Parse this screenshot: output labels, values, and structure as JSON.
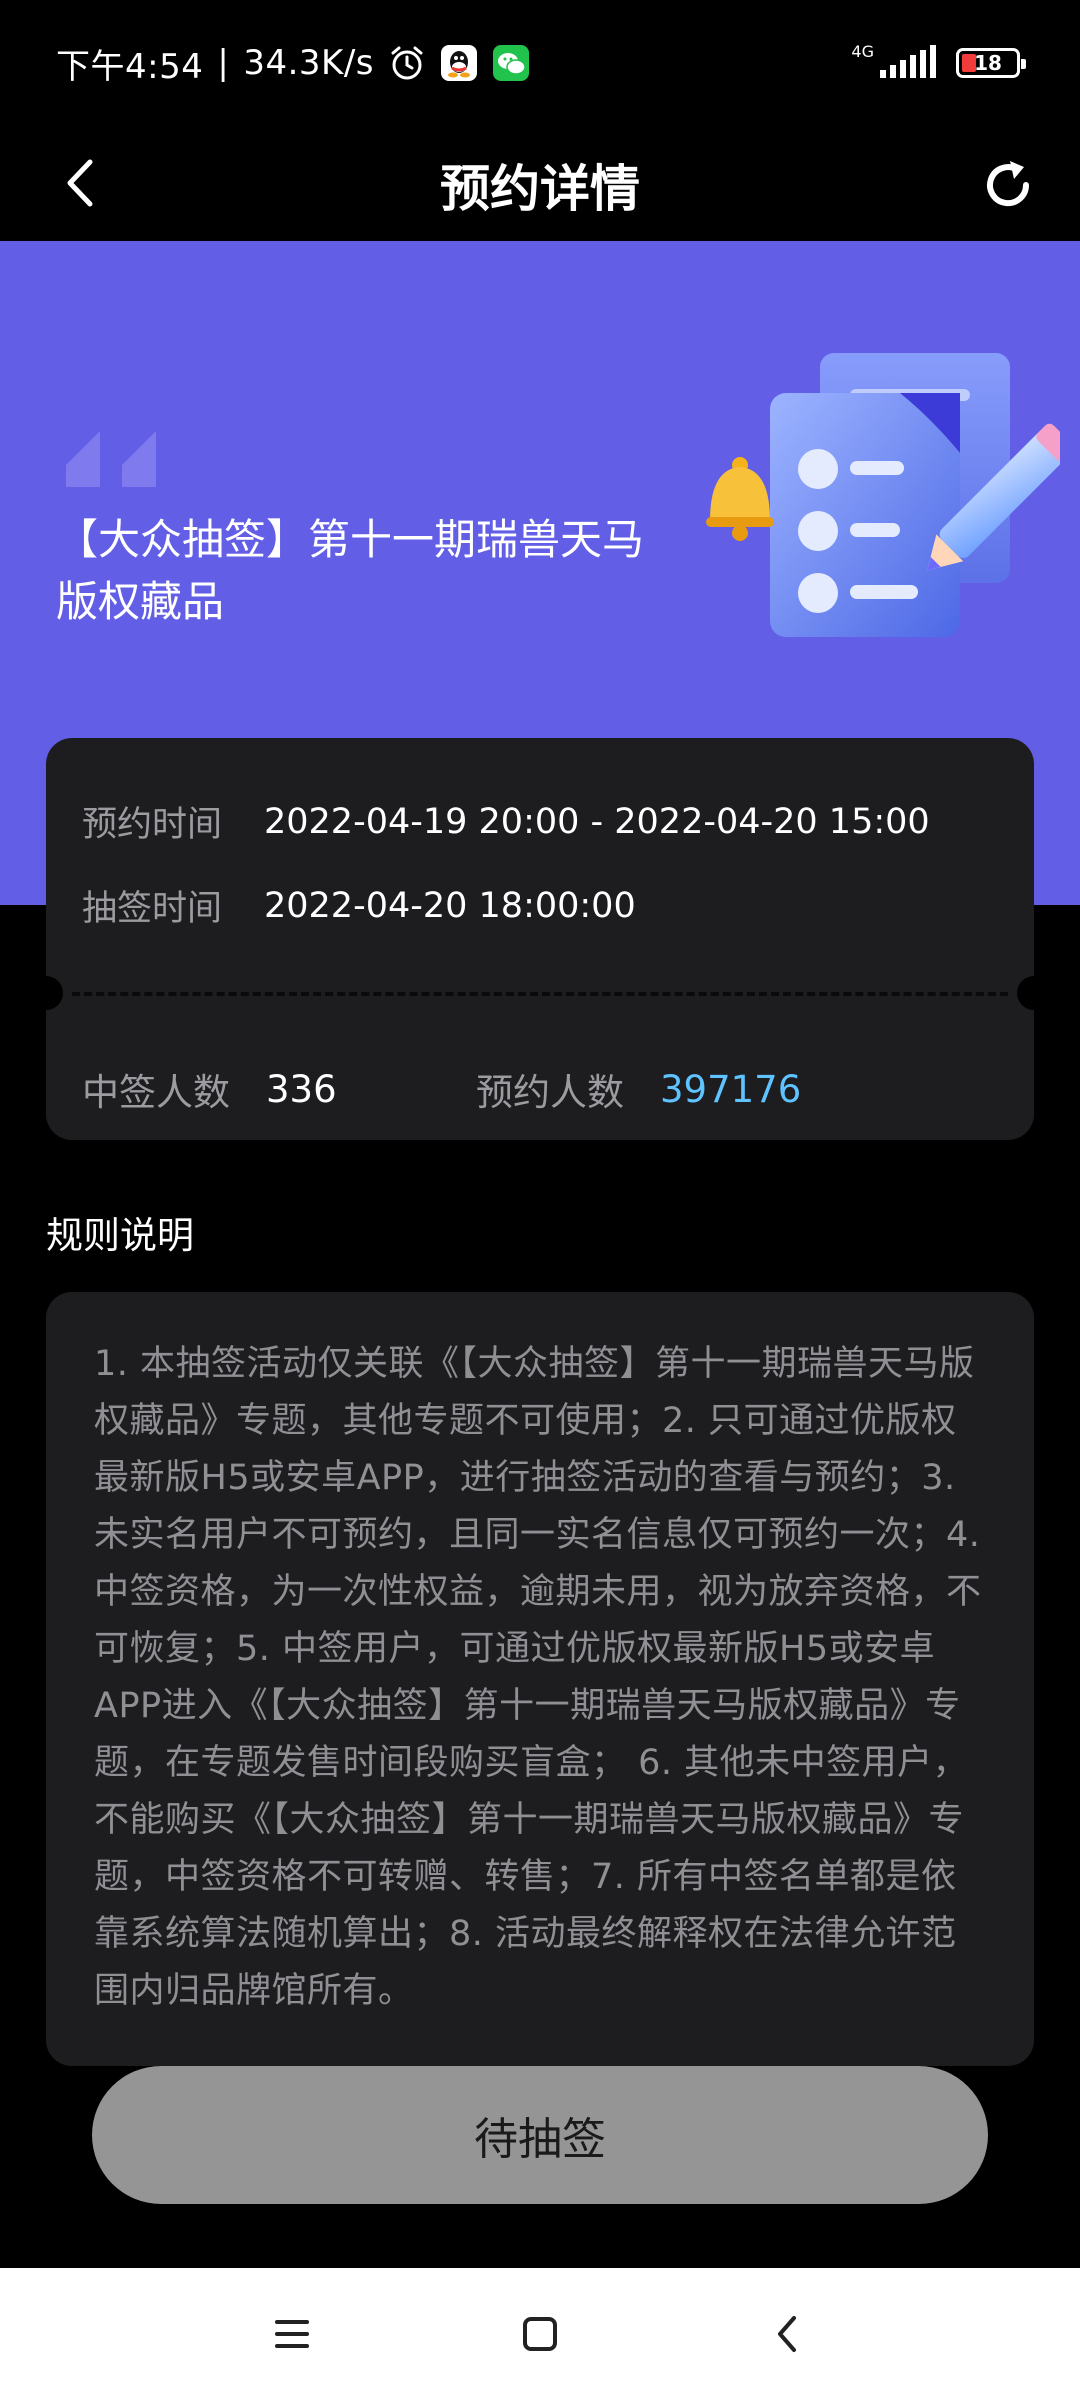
{
  "status_bar": {
    "time": "下午4:54",
    "speed": "34.3K/s",
    "network_type": "4G",
    "battery_level": "18",
    "icons": [
      "alarm-icon",
      "qq-icon",
      "wechat-icon",
      "signal-icon",
      "battery-icon"
    ]
  },
  "nav": {
    "title": "预约详情",
    "back_icon": "chevron-left-icon",
    "refresh_icon": "refresh-icon"
  },
  "hero": {
    "title": "【大众抽签】第十一期瑞兽天马版权藏品",
    "background_color": "#625ee6"
  },
  "info": {
    "reserve_time_label": "预约时间",
    "reserve_time_value": "2022-04-19 20:00 - 2022-04-20 15:00",
    "draw_time_label": "抽签时间",
    "draw_time_value": "2022-04-20 18:00:00",
    "winners_label": "中签人数",
    "winners_value": "336",
    "reservations_label": "预约人数",
    "reservations_value": "397176",
    "highlight_color": "#5ec3ff"
  },
  "rules": {
    "heading": "规则说明",
    "text": "1. 本抽签活动仅关联《【大众抽签】第十一期瑞兽天马版权藏品》专题，其他专题不可使用；2. 只可通过优版权最新版H5或安卓APP，进行抽签活动的查看与预约；3. 未实名用户不可预约，且同一实名信息仅可预约一次；4. 中签资格，为一次性权益，逾期未用，视为放弃资格，不可恢复；5. 中签用户，可通过优版权最新版H5或安卓APP进入《【大众抽签】第十一期瑞兽天马版权藏品》专题，在专题发售时间段购买盲盒； 6. 其他未中签用户，不能购买《【大众抽签】第十一期瑞兽天马版权藏品》专题，中签资格不可转赠、转售；7. 所有中签名单都是依靠系统算法随机算出；8. 活动最终解释权在法律允许范围内归品牌馆所有。"
  },
  "cta": {
    "label": "待抽签"
  },
  "system_nav": {
    "icons": [
      "menu-icon",
      "home-square-icon",
      "back-icon"
    ]
  }
}
